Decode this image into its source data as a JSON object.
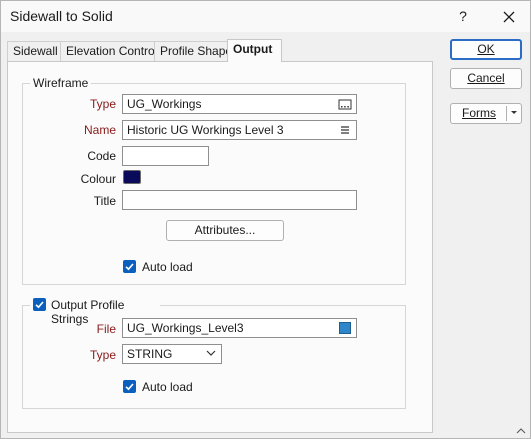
{
  "window": {
    "title": "Sidewall to Solid",
    "help_label": "?",
    "close_icon": "close-icon"
  },
  "tabs": [
    {
      "label": "Sidewall",
      "active": false
    },
    {
      "label": "Elevation Control",
      "active": false
    },
    {
      "label": "Profile Shape",
      "active": false
    },
    {
      "label": "Output",
      "active": true
    }
  ],
  "wireframe": {
    "legend": "Wireframe",
    "type_label": "Type",
    "type_value": "UG_Workings",
    "type_icon": "ellipsis-browse-icon",
    "name_label": "Name",
    "name_value": "Historic UG Workings Level 3",
    "name_icon": "list-icon",
    "code_label": "Code",
    "code_value": "",
    "colour_label": "Colour",
    "colour_value": "#0a0a5a",
    "title_label": "Title",
    "title_value": "",
    "attributes_button": "Attributes...",
    "autoload_label": "Auto load",
    "autoload_checked": true
  },
  "profile": {
    "checkbox_label": "Output Profile Strings",
    "checked": true,
    "file_label": "File",
    "file_value": "UG_Workings_Level3",
    "file_icon": "file-square-icon",
    "type_label": "Type",
    "type_value": "STRING",
    "autoload_label": "Auto load",
    "autoload_checked": true
  },
  "buttons": {
    "ok": "OK",
    "cancel": "Cancel",
    "forms": "Forms"
  },
  "colors": {
    "accent": "#0b5fbd",
    "required_label": "#8a1b1b",
    "file_icon": "#2e86c9"
  }
}
